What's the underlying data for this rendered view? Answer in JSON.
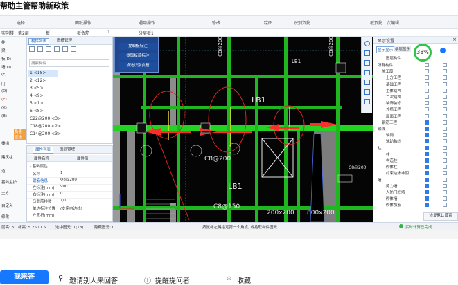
{
  "page": {
    "title": "帮助主管帮助新政策"
  },
  "ribbon": {
    "groups": [
      "选择",
      "图纸操作",
      "通用操作",
      "修改",
      "绘图",
      "识别负筋",
      "板负筋二次编辑"
    ]
  },
  "toolbar": {
    "items": [
      "实创楼",
      "第2层",
      "板",
      "板负筋",
      "1",
      "分层板1"
    ]
  },
  "left_nav": {
    "items": [
      "柱",
      "梁",
      "板(D)",
      "墙(D)",
      "(F)",
      "门",
      "(D)",
      "(E)",
      "(K)",
      "(B)",
      "楼梯",
      "建筑柱",
      "道",
      "基础主护",
      "土方",
      "自定义",
      "修改"
    ],
    "badge": "负素正级"
  },
  "component_list": {
    "tabs": [
      "构件列表",
      "图纸管理"
    ],
    "search_placeholder": "搜索构件...",
    "items": [
      "1 <18>",
      "2 <12>",
      "3 <5>",
      "4 <9>",
      "5 <1>",
      "6 <8>",
      "C22@200 <3>",
      "C18@200 <2>",
      "C14@200 <3>"
    ]
  },
  "properties": {
    "tabs": [
      "属性列表",
      "图层管理"
    ],
    "columns": [
      "属性名称",
      "属性值"
    ],
    "group": "- 基础属性",
    "rows": [
      {
        "name": "名称",
        "value": "1"
      },
      {
        "name": "钢筋信息",
        "value": "Φ8@200"
      },
      {
        "name": "左标注(mm)",
        "value": "900"
      },
      {
        "name": "右标注(mm)",
        "value": "0"
      },
      {
        "name": "马凳筋排数",
        "value": "1/1"
      },
      {
        "name": "单边标注位置",
        "value": "(支座内边线)"
      },
      {
        "name": "左弯折(mm)",
        "value": ""
      }
    ]
  },
  "cad_menu": {
    "items": [
      "提取板标注",
      "提取板筋标注",
      "点选识别负筋"
    ]
  },
  "canvas": {
    "labels": [
      "LB1",
      "C8@200",
      "LB1",
      "C8@150",
      "200x200",
      "800x200",
      "C8@200",
      "LB1",
      "C8@200",
      "C8@200"
    ]
  },
  "settings": {
    "title": "显示设置",
    "tabs": [
      "显示显示",
      "楼层显示"
    ],
    "col_header": "图层构件",
    "zoom": "38%",
    "tree": [
      {
        "label": "所有构件",
        "indent": 0,
        "a": false,
        "b": false
      },
      {
        "label": "施工段",
        "indent": 1,
        "a": false,
        "b": false
      },
      {
        "label": "土方工程",
        "indent": 2,
        "a": false,
        "b": false
      },
      {
        "label": "基础工程",
        "indent": 2,
        "a": false,
        "b": false
      },
      {
        "label": "主体结构",
        "indent": 2,
        "a": false,
        "b": false
      },
      {
        "label": "二次结构",
        "indent": 2,
        "a": false,
        "b": false
      },
      {
        "label": "装饰装修",
        "indent": 2,
        "a": false,
        "b": false
      },
      {
        "label": "外墙工程",
        "indent": 2,
        "a": false,
        "b": false
      },
      {
        "label": "屋面工程",
        "indent": 2,
        "a": false,
        "b": false
      },
      {
        "label": "钢筋工程",
        "indent": 1,
        "a": true,
        "b": false
      },
      {
        "label": "轴线",
        "indent": 0,
        "a": true,
        "b": false
      },
      {
        "label": "轴网",
        "indent": 2,
        "a": true,
        "b": false
      },
      {
        "label": "辅助轴线",
        "indent": 2,
        "a": true,
        "b": false
      },
      {
        "label": "柱",
        "indent": 0,
        "a": true,
        "b": false
      },
      {
        "label": "柱",
        "indent": 2,
        "a": true,
        "b": false
      },
      {
        "label": "构造柱",
        "indent": 2,
        "a": true,
        "b": false
      },
      {
        "label": "砌体柱",
        "indent": 2,
        "a": true,
        "b": false
      },
      {
        "label": "约束边缘非阴",
        "indent": 2,
        "a": true,
        "b": false
      },
      {
        "label": "墙",
        "indent": 0,
        "a": true,
        "b": false
      },
      {
        "label": "剪力墙",
        "indent": 2,
        "a": true,
        "b": false
      },
      {
        "label": "人防门框墙",
        "indent": 2,
        "a": true,
        "b": false
      },
      {
        "label": "砌体墙",
        "indent": 2,
        "a": true,
        "b": false
      },
      {
        "label": "砌体加筋",
        "indent": 2,
        "a": true,
        "b": false
      }
    ],
    "reset_label": "恢复默认设置"
  },
  "statusbar": {
    "items": [
      "层高: 3",
      "标高: 5.2~11.5",
      "选中图元: 1(18)",
      "隐藏图元: 0",
      "按鼠标左键指定第一个角点, 或拾取构件图元",
      "实时计算已完成"
    ]
  },
  "actions": {
    "answer": "我来答",
    "invite": "邀请别人来回答",
    "report": "提醒提问者",
    "favorite": "收藏"
  }
}
